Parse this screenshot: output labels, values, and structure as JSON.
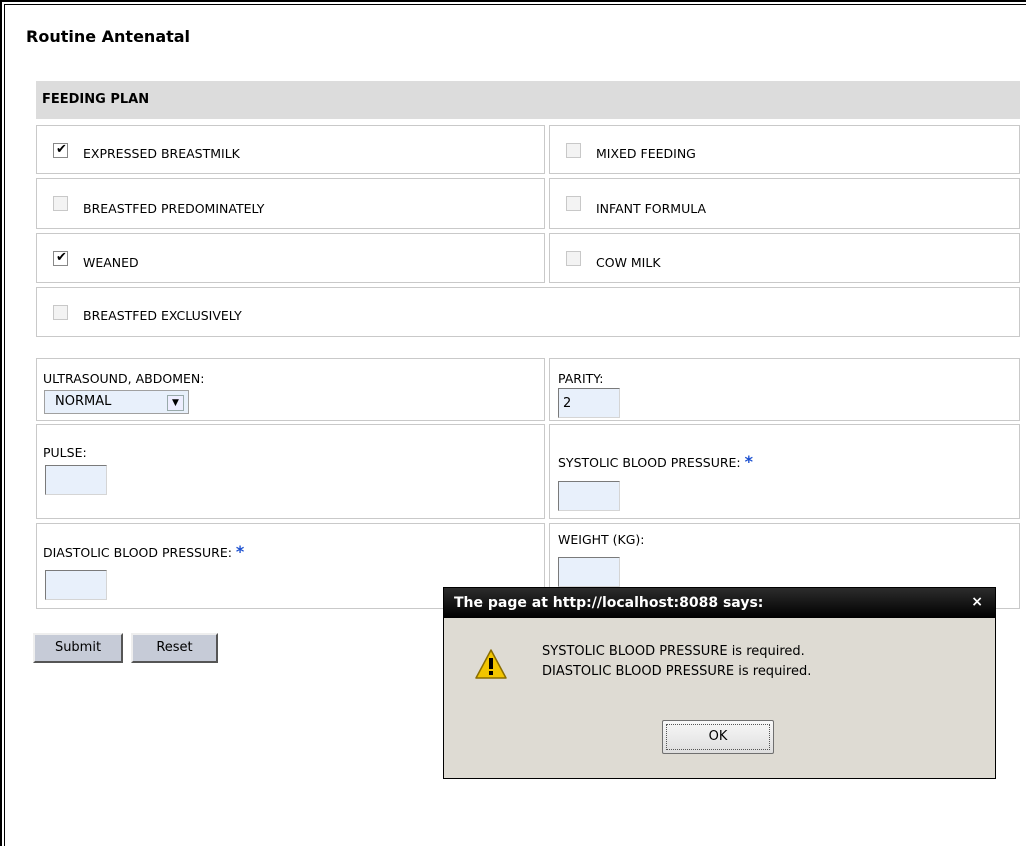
{
  "page": {
    "title": "Routine Antenatal"
  },
  "feeding_plan": {
    "header": "FEEDING PLAN",
    "options": [
      {
        "label": "EXPRESSED BREASTMILK",
        "checked": true
      },
      {
        "label": "MIXED FEEDING",
        "checked": false
      },
      {
        "label": "BREASTFED PREDOMINATELY",
        "checked": false
      },
      {
        "label": "INFANT FORMULA",
        "checked": false
      },
      {
        "label": "WEANED",
        "checked": true
      },
      {
        "label": "COW MILK",
        "checked": false
      },
      {
        "label": "BREASTFED EXCLUSIVELY",
        "checked": false
      }
    ]
  },
  "fields": {
    "ultrasound_label": "ULTRASOUND, ABDOMEN:",
    "ultrasound_value": "NORMAL",
    "parity_label": "PARITY:",
    "parity_value": "2",
    "pulse_label": "PULSE:",
    "pulse_value": "",
    "systolic_label": "SYSTOLIC BLOOD PRESSURE:",
    "systolic_value": "",
    "diastolic_label": "DIASTOLIC BLOOD PRESSURE:",
    "diastolic_value": "",
    "weight_label": "WEIGHT (KG):",
    "weight_value": "",
    "required_marker": "*"
  },
  "buttons": {
    "submit": "Submit",
    "reset": "Reset"
  },
  "dialog": {
    "title": "The page at http://localhost:8088 says:",
    "close": "×",
    "messages": [
      "SYSTOLIC BLOOD PRESSURE is required.",
      "DIASTOLIC BLOOD PRESSURE is required."
    ],
    "ok": "OK"
  },
  "icons": {
    "select_arrow": "chevron-down-icon",
    "alert": "warning-icon"
  },
  "colors": {
    "header_bg": "#dcdcdc",
    "required": "#1a4fd0",
    "dialog_title_bg": "#000000",
    "warning": "#f2c500"
  }
}
